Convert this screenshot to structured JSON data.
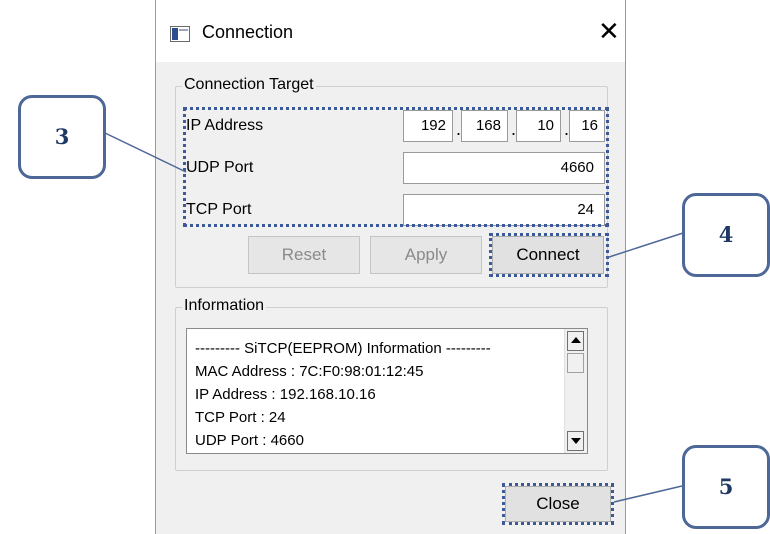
{
  "window": {
    "title": "Connection",
    "close_glyph": "✕",
    "app_icon": "app-window-icon"
  },
  "connection_target": {
    "legend": "Connection Target",
    "ip_label": "IP Address",
    "ip_octets": [
      "192",
      "168",
      "10",
      "16"
    ],
    "ip_separator": ".",
    "udp_label": "UDP Port",
    "udp_value": "4660",
    "tcp_label": "TCP Port",
    "tcp_value": "24"
  },
  "buttons": {
    "reset": "Reset",
    "apply": "Apply",
    "connect": "Connect",
    "close": "Close"
  },
  "information": {
    "legend": "Information",
    "lines": [
      "--------- SiTCP(EEPROM) Information ---------",
      "MAC Address : 7C:F0:98:01:12:45",
      "IP Address : 192.168.10.16",
      "TCP Port : 24",
      "UDP Port : 4660"
    ]
  },
  "callouts": {
    "c3": "3",
    "c4": "4",
    "c5": "5"
  },
  "colors": {
    "callout_border": "#4d6797",
    "callout_text": "#1f3864",
    "highlight": "#3c5a9a"
  }
}
